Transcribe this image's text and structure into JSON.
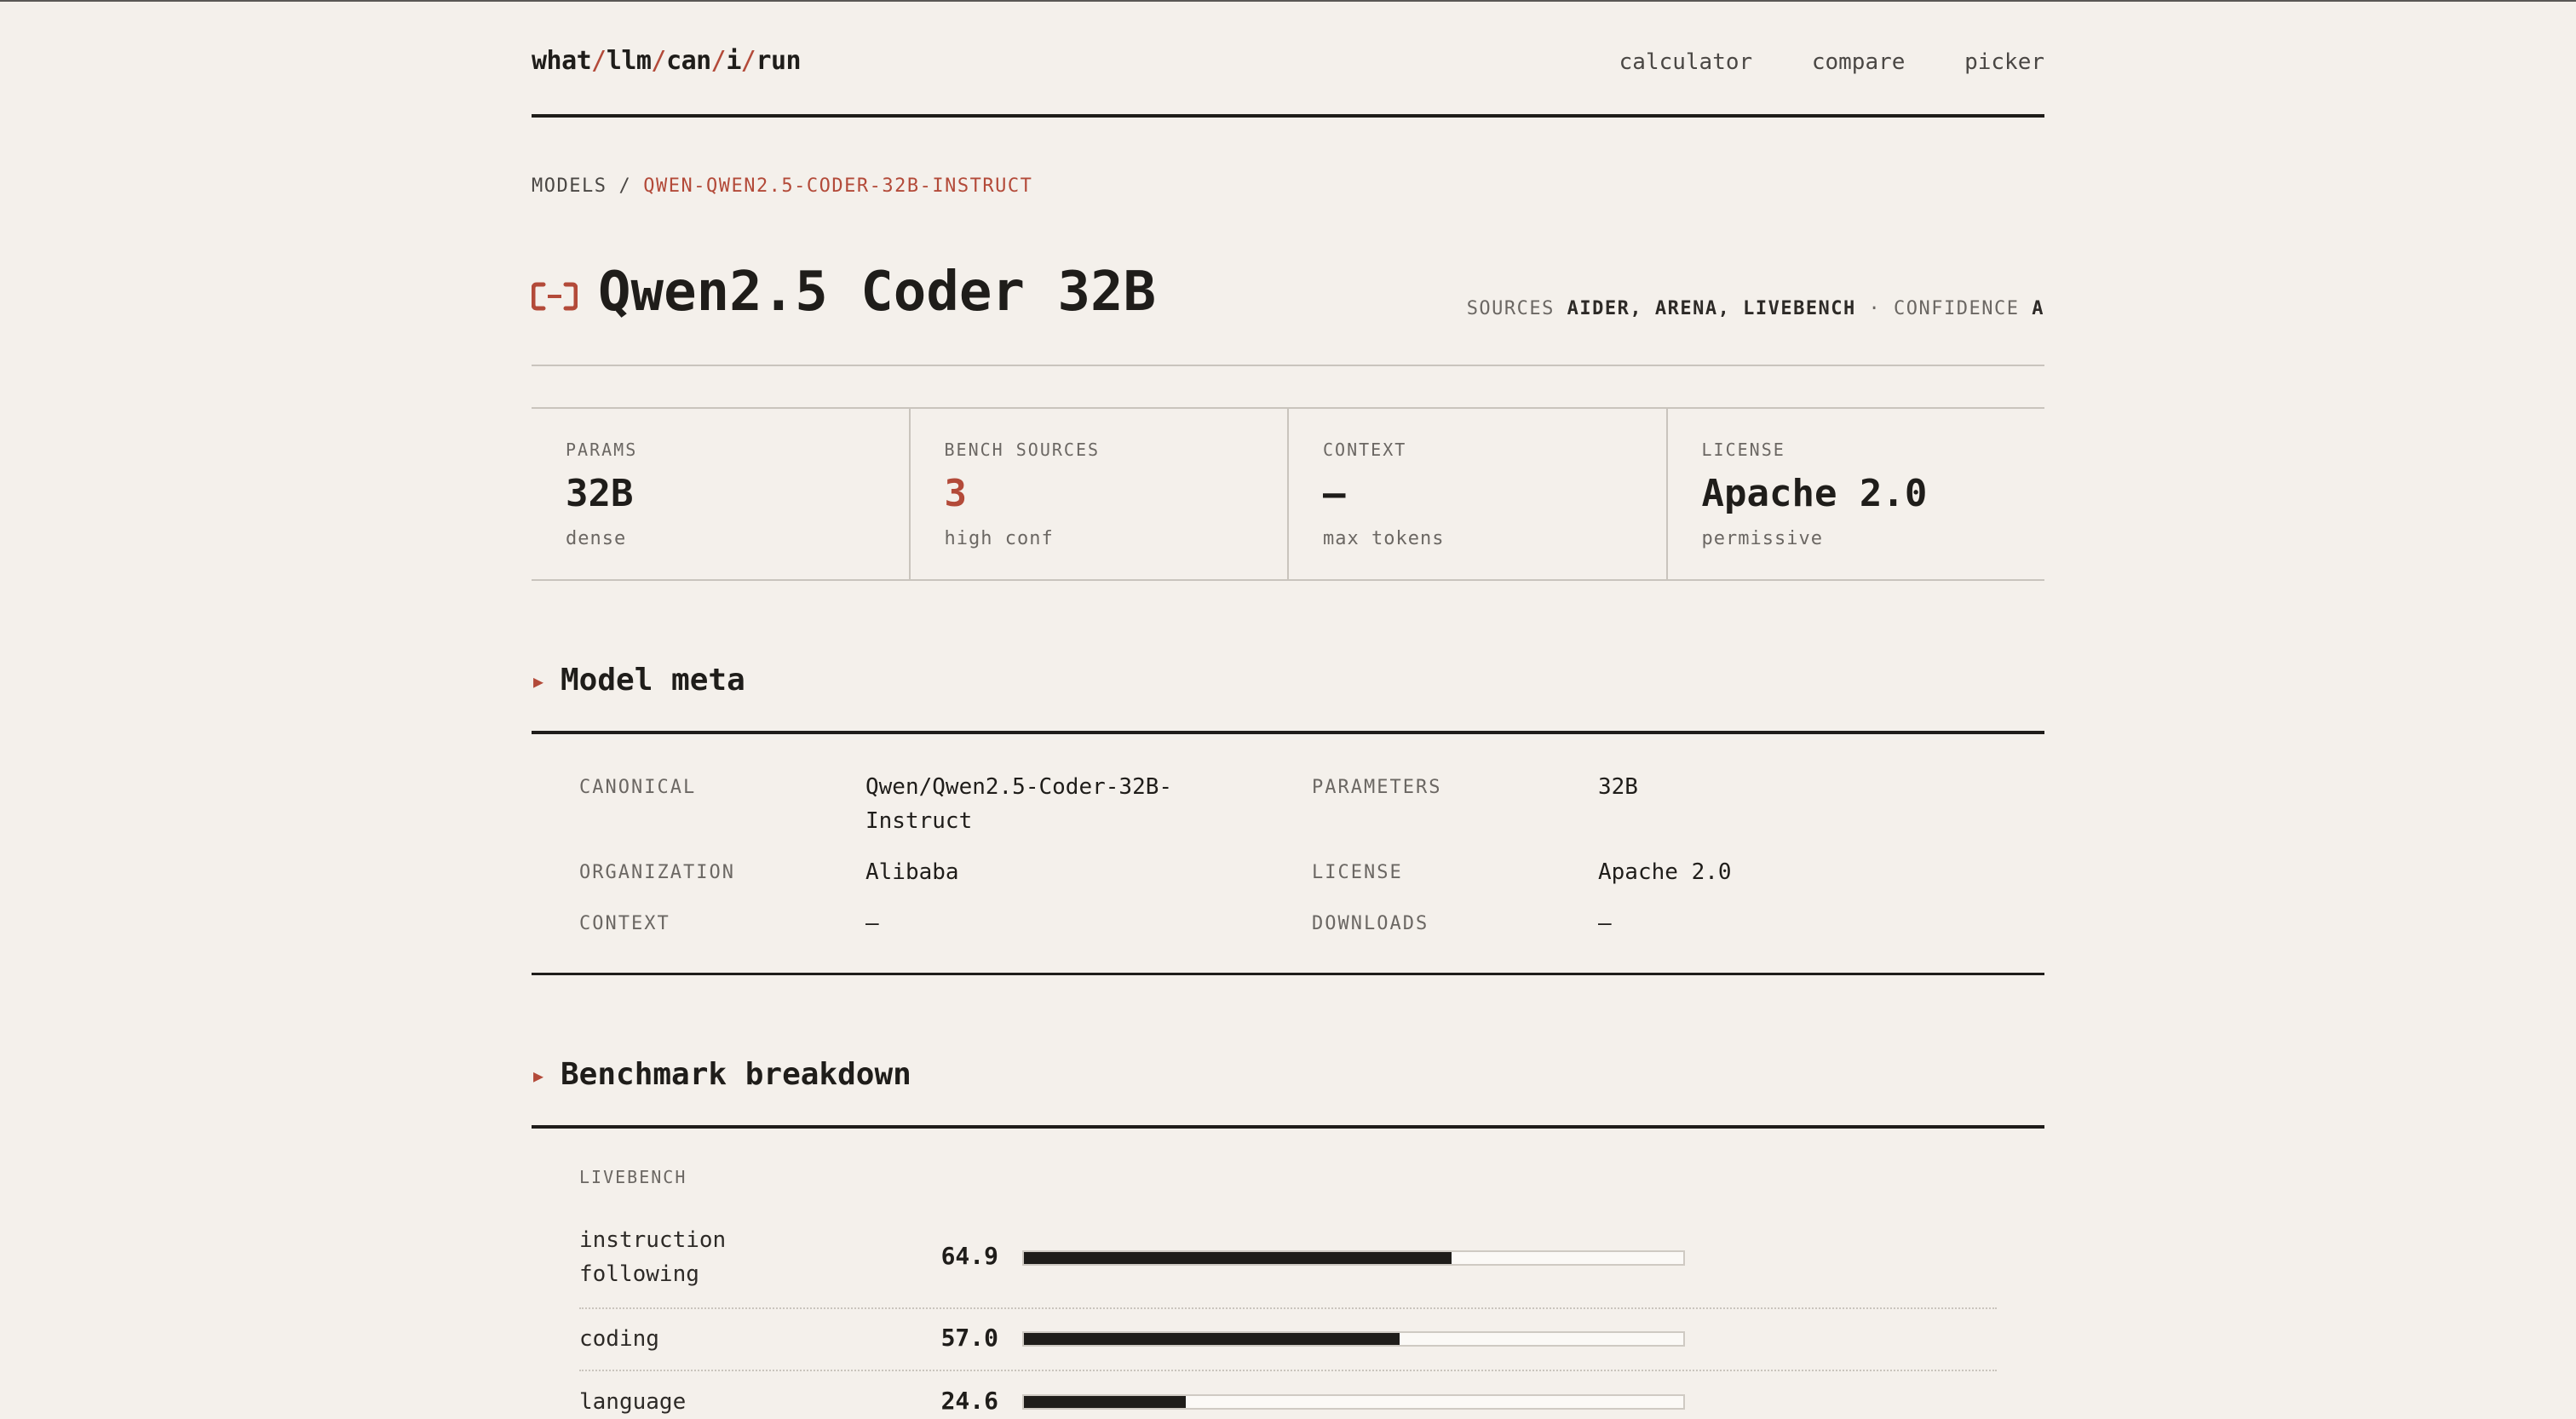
{
  "header": {
    "logo_parts": [
      "what",
      "llm",
      "can",
      "i",
      "run"
    ],
    "logo_sep": "/",
    "nav": [
      "calculator",
      "compare",
      "picker"
    ]
  },
  "breadcrumb": {
    "root": "MODELS",
    "sep": "/",
    "current": "QWEN-QWEN2.5-CODER-32B-INSTRUCT"
  },
  "model": {
    "title": "Qwen2.5 Coder 32B",
    "brand_icon": "alibaba-cloud-icon",
    "sources_label": "SOURCES",
    "sources_value": "AIDER, ARENA, LIVEBENCH",
    "dot": "·",
    "confidence_label": "CONFIDENCE",
    "confidence_value": "A"
  },
  "stats": [
    {
      "label": "PARAMS",
      "value": "32B",
      "sub": "dense"
    },
    {
      "label": "BENCH SOURCES",
      "value": "3",
      "sub": "high conf"
    },
    {
      "label": "CONTEXT",
      "value": "—",
      "sub": "max tokens"
    },
    {
      "label": "LICENSE",
      "value": "Apache 2.0",
      "sub": "permissive"
    }
  ],
  "meta_section": {
    "heading": "Model meta",
    "rows": [
      {
        "label": "CANONICAL",
        "value": "Qwen/Qwen2.5-Coder-32B-Instruct"
      },
      {
        "label": "PARAMETERS",
        "value": "32B"
      },
      {
        "label": "ORGANIZATION",
        "value": "Alibaba"
      },
      {
        "label": "LICENSE",
        "value": "Apache 2.0"
      },
      {
        "label": "CONTEXT",
        "value": "—"
      },
      {
        "label": "DOWNLOADS",
        "value": "—"
      }
    ]
  },
  "bench_section": {
    "heading": "Benchmark breakdown",
    "source": "LIVEBENCH",
    "max": 100,
    "items": [
      {
        "name": "instruction following",
        "score": 64.9,
        "score_text": "64.9"
      },
      {
        "name": "coding",
        "score": 57.0,
        "score_text": "57.0"
      },
      {
        "name": "language",
        "score": 24.6,
        "score_text": "24.6"
      }
    ]
  },
  "colors": {
    "background": "#f4f0eb",
    "accent": "#b34a39",
    "ink": "#1f1d1a"
  }
}
